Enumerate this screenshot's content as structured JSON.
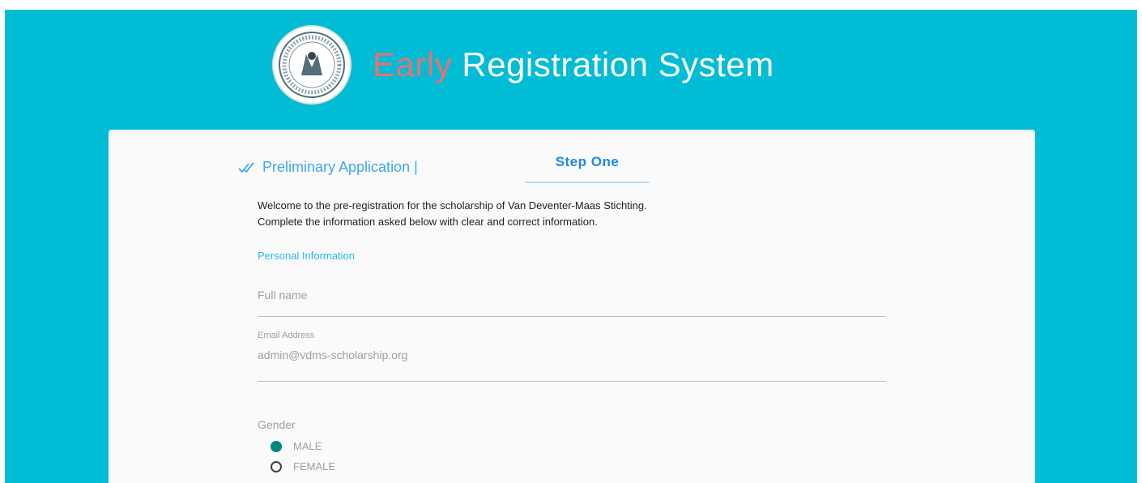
{
  "header": {
    "title_accent": "Early",
    "title_rest": " Registration System",
    "logo_icon": "foundation-seal-icon"
  },
  "tabs": {
    "preliminary": "Preliminary Application |",
    "step_one": "Step One"
  },
  "intro": {
    "line1": "Welcome to the pre-registration for the scholarship of Van Deventer-Maas Stichting.",
    "line2": "Complete the information asked below with clear and correct information."
  },
  "personal_info": {
    "section_label": "Personal Information",
    "full_name_placeholder": "Full name",
    "email_label": "Email Address",
    "email_value": "admin@vdms-scholarship.org"
  },
  "gender": {
    "label": "Gender",
    "options": [
      "MALE",
      "FEMALE"
    ],
    "selected": "MALE"
  },
  "colors": {
    "page_background": "#00bcd4",
    "title_accent": "#e57373",
    "tab_text": "#1e88e5",
    "link_text": "#29b6f6",
    "radio_selected": "#00897b"
  }
}
